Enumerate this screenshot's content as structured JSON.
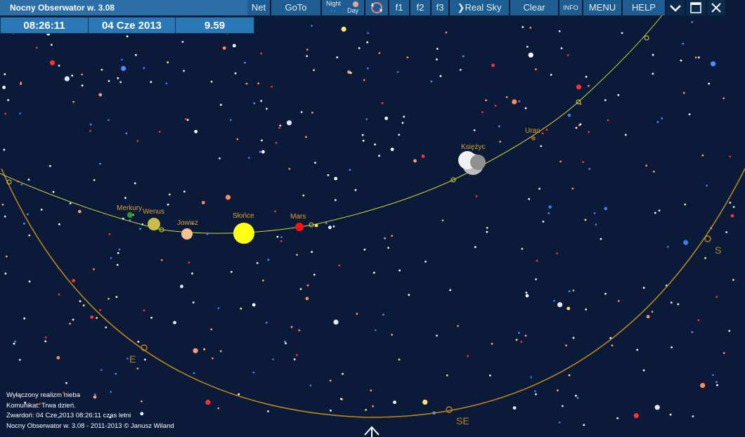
{
  "window": {
    "title": "Nocny Obserwator w. 3.08"
  },
  "info": {
    "time": "08:26:11",
    "date": "04 Cze 2013",
    "value": "9.59"
  },
  "toolbar": {
    "net": "Net",
    "goto": "GoTo",
    "night": "Night",
    "day": "Day",
    "f1": "f1",
    "f2": "f2",
    "f3": "f3",
    "real_sky": "Real Sky",
    "clear": "Clear",
    "info": "INFO",
    "menu": "MENU",
    "help": "HELP"
  },
  "sky": {
    "directions": {
      "east": "E",
      "southeast": "SE",
      "south": "S"
    },
    "bodies": [
      {
        "name": "Merkury",
        "color": "#22a02a"
      },
      {
        "name": "Wenus",
        "color": "#c8bd4a"
      },
      {
        "name": "Jowisz",
        "color": "#f3c291"
      },
      {
        "name": "Słońce",
        "color": "#ffff14"
      },
      {
        "name": "Mars",
        "color": "#ff1010"
      },
      {
        "name": "Księżyc",
        "color": "#bdbdbd"
      },
      {
        "name": "Uran",
        "color": "#8b5a2b"
      }
    ],
    "label_color": "#e0a030",
    "ecliptic_color": "#d8d83a",
    "horizon_color": "#b8861e"
  },
  "status": {
    "line1": "Wyłączony realizm nieba",
    "line2": "Komunikat: Trwa dzień.",
    "line3": "Zwardoń:  04 Cze 2013   08:26:11   czas letni",
    "line4": "Nocny Obserwator w. 3.08 - 2011-2013 © Janusz Wiland"
  }
}
